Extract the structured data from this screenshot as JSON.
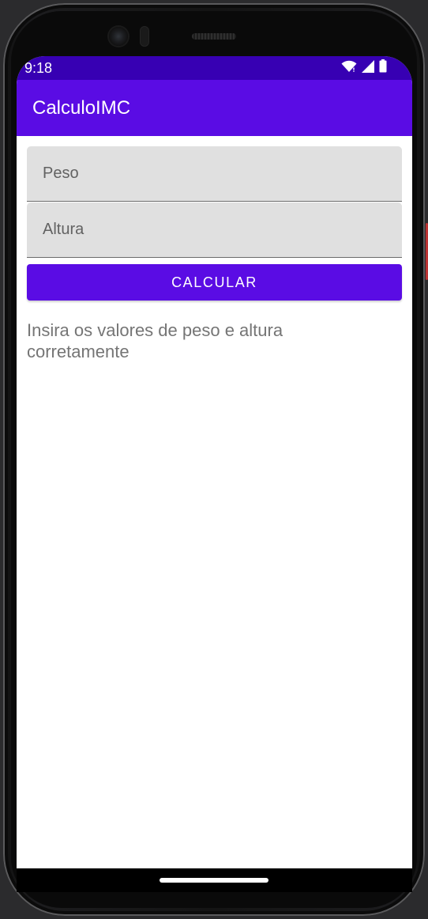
{
  "status_bar": {
    "time": "9:18",
    "icons": [
      "wifi-icon",
      "signal-icon",
      "battery-icon"
    ]
  },
  "app_bar": {
    "title": "CalculoIMC"
  },
  "form": {
    "peso_placeholder": "Peso",
    "altura_placeholder": "Altura",
    "calcular_label": "CALCULAR"
  },
  "result": {
    "text": "Insira os valores de peso e altura corretamente"
  },
  "colors": {
    "primary": "#5a0ce4",
    "primary_dark": "#3700b3",
    "field_bg": "#e0e0e0",
    "hint_text": "#757575"
  }
}
